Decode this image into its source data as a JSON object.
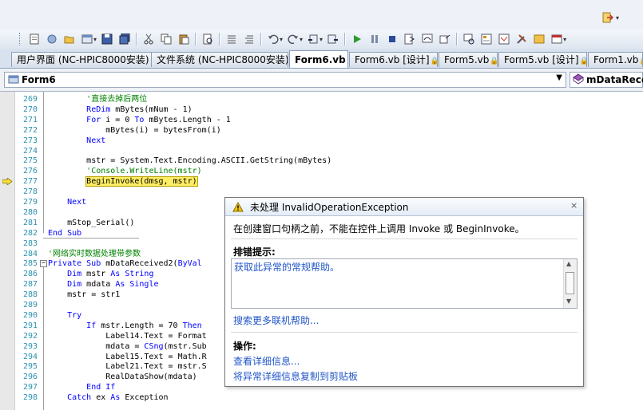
{
  "tabs": [
    {
      "label": "用户界面 (NC-HPIC8000安装)",
      "active": false,
      "locked": false
    },
    {
      "label": "文件系统 (NC-HPIC8000安装)",
      "active": false,
      "locked": false
    },
    {
      "label": "Form6.vb",
      "active": true,
      "locked": true
    },
    {
      "label": "Form6.vb [设计]",
      "active": false,
      "locked": true
    },
    {
      "label": "Form5.vb",
      "active": false,
      "locked": true
    },
    {
      "label": "Form5.vb [设计]",
      "active": false,
      "locked": true
    },
    {
      "label": "Form1.vb",
      "active": false,
      "locked": true
    }
  ],
  "navigation": {
    "class_selector": "Form6",
    "member_selector": "mDataRecei"
  },
  "code_lines": [
    {
      "num": "269",
      "indent": "        ",
      "parts": [
        {
          "t": "'直接去掉后两位",
          "c": "cm"
        }
      ]
    },
    {
      "num": "270",
      "indent": "        ",
      "parts": [
        {
          "t": "ReDim",
          "c": "kw"
        },
        {
          "t": " mBytes(mNum - 1)",
          "c": ""
        }
      ]
    },
    {
      "num": "271",
      "indent": "        ",
      "parts": [
        {
          "t": "For",
          "c": "kw"
        },
        {
          "t": " i = 0 ",
          "c": ""
        },
        {
          "t": "To",
          "c": "kw"
        },
        {
          "t": " mBytes.Length - 1",
          "c": ""
        }
      ]
    },
    {
      "num": "272",
      "indent": "            ",
      "parts": [
        {
          "t": "mBytes(i) = bytesFrom(i)",
          "c": ""
        }
      ]
    },
    {
      "num": "273",
      "indent": "        ",
      "parts": [
        {
          "t": "Next",
          "c": "kw"
        }
      ]
    },
    {
      "num": "274",
      "indent": "",
      "parts": []
    },
    {
      "num": "275",
      "indent": "        ",
      "parts": [
        {
          "t": "mstr = System.Text.Encoding.ASCII.GetString(mBytes)",
          "c": ""
        }
      ]
    },
    {
      "num": "276",
      "indent": "        ",
      "parts": [
        {
          "t": "'Console.WriteLine(mstr)",
          "c": "cm"
        }
      ]
    },
    {
      "num": "277",
      "indent": "        ",
      "parts": [
        {
          "t": "BeginInvoke(dmsg, mstr)",
          "c": ""
        }
      ],
      "highlight": true
    },
    {
      "num": "278",
      "indent": "",
      "parts": []
    },
    {
      "num": "279",
      "indent": "    ",
      "parts": [
        {
          "t": "Next",
          "c": "kw"
        }
      ]
    },
    {
      "num": "280",
      "indent": "",
      "parts": []
    },
    {
      "num": "281",
      "indent": "    ",
      "parts": [
        {
          "t": "mStop_Serial()",
          "c": ""
        }
      ]
    },
    {
      "num": "282",
      "indent": "",
      "parts": [
        {
          "t": "End Sub",
          "c": "kw"
        }
      ]
    },
    {
      "num": "283",
      "indent": "",
      "parts": []
    },
    {
      "num": "284",
      "indent": "",
      "parts": [
        {
          "t": "'网络实时数据处理带参数",
          "c": "cm"
        }
      ]
    },
    {
      "num": "285",
      "indent": "",
      "parts": [
        {
          "t": "Private Sub",
          "c": "kw"
        },
        {
          "t": " mDataReceived2(",
          "c": ""
        },
        {
          "t": "ByVal",
          "c": "kw"
        }
      ]
    },
    {
      "num": "286",
      "indent": "    ",
      "parts": [
        {
          "t": "Dim",
          "c": "kw"
        },
        {
          "t": " mstr ",
          "c": ""
        },
        {
          "t": "As String",
          "c": "kw"
        }
      ]
    },
    {
      "num": "287",
      "indent": "    ",
      "parts": [
        {
          "t": "Dim",
          "c": "kw"
        },
        {
          "t": " mdata ",
          "c": ""
        },
        {
          "t": "As Single",
          "c": "kw"
        }
      ]
    },
    {
      "num": "288",
      "indent": "    ",
      "parts": [
        {
          "t": "mstr = str1",
          "c": ""
        }
      ]
    },
    {
      "num": "289",
      "indent": "",
      "parts": []
    },
    {
      "num": "290",
      "indent": "    ",
      "parts": [
        {
          "t": "Try",
          "c": "kw"
        }
      ]
    },
    {
      "num": "291",
      "indent": "        ",
      "parts": [
        {
          "t": "If",
          "c": "kw"
        },
        {
          "t": " mstr.Length = 70 ",
          "c": ""
        },
        {
          "t": "Then",
          "c": "kw"
        }
      ]
    },
    {
      "num": "292",
      "indent": "            ",
      "parts": [
        {
          "t": "Label14.Text = Format",
          "c": ""
        }
      ]
    },
    {
      "num": "293",
      "indent": "            ",
      "parts": [
        {
          "t": "mdata = ",
          "c": ""
        },
        {
          "t": "CSng",
          "c": "kw"
        },
        {
          "t": "(mstr.Sub",
          "c": ""
        }
      ]
    },
    {
      "num": "294",
      "indent": "            ",
      "parts": [
        {
          "t": "Label15.Text = Math.R",
          "c": ""
        }
      ]
    },
    {
      "num": "295",
      "indent": "            ",
      "parts": [
        {
          "t": "Label21.Text = mstr.S",
          "c": ""
        }
      ]
    },
    {
      "num": "296",
      "indent": "            ",
      "parts": [
        {
          "t": "RealDataShow(mdata)",
          "c": ""
        }
      ]
    },
    {
      "num": "297",
      "indent": "        ",
      "parts": [
        {
          "t": "End If",
          "c": "kw"
        }
      ]
    },
    {
      "num": "298",
      "indent": "    ",
      "parts": [
        {
          "t": "Catch",
          "c": "kw"
        },
        {
          "t": " ex ",
          "c": ""
        },
        {
          "t": "As",
          "c": "kw"
        },
        {
          "t": " Exception",
          "c": ""
        }
      ]
    }
  ],
  "exception_popup": {
    "title": "未处理 InvalidOperationException",
    "message": "在创建窗口句柄之前，不能在控件上调用 Invoke 或 BeginInvoke。",
    "tips_heading": "排错提示:",
    "tips_link": "获取此异常的常规帮助。",
    "more_help_link": "搜索更多联机帮助...",
    "actions_heading": "操作:",
    "action_view_details": "查看详细信息...",
    "action_copy": "将异常详细信息复制到剪贴板",
    "close_glyph": "×"
  },
  "colors": {
    "keyword": "#0000ff",
    "comment": "#008000",
    "line_number": "#2b91af",
    "link": "#2056c8",
    "highlight": "#ffee62"
  }
}
